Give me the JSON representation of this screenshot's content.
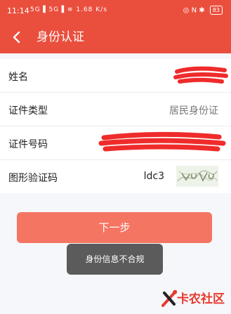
{
  "status_bar": {
    "time": "11:14",
    "signal_icons_text": "5G▐ 5G▐ ≋ 1.68 K/s",
    "right_icons_text": "◎ N ✱",
    "battery": "83"
  },
  "nav": {
    "title": "身份认证"
  },
  "form": {
    "name_label": "姓名",
    "id_type_label": "证件类型",
    "id_type_value": "居民身份证",
    "id_number_label": "证件号码",
    "captcha_label": "图形验证码",
    "captcha_input_value": "ldc3"
  },
  "next_button_label": "下一步",
  "toast_message": "身份信息不合规",
  "watermark_text": "卡农社区",
  "colors": {
    "brand_red": "#ea4f3e",
    "button": "#f47562",
    "toast": "#5b5b5b"
  }
}
